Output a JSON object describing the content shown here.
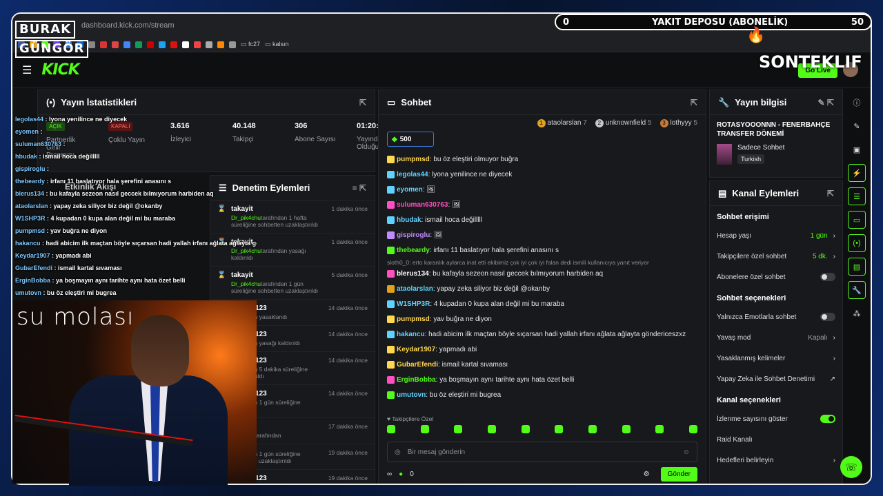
{
  "browser": {
    "url": "dashboard.kick.com/stream",
    "bookmarks": [
      "fc27",
      "kalsın"
    ]
  },
  "header": {
    "logo": "KICK",
    "go_live": "Go Live"
  },
  "stats_panel": {
    "title": "Yayın İstatistikleri",
    "items": [
      {
        "value": "AÇIK",
        "label": "Partnerlik Gelir Programı"
      },
      {
        "value": "KAPALI",
        "label": "Çoklu Yayın"
      },
      {
        "value": "3.616",
        "label": "İzleyici"
      },
      {
        "value": "40.148",
        "label": "Takipçi"
      },
      {
        "value": "306",
        "label": "Abone Sayısı"
      },
      {
        "value": "01:20:51",
        "label": "Yayında Olduğu Süre"
      }
    ]
  },
  "moderation": {
    "title": "Denetim Eylemleri",
    "items": [
      {
        "name": "takayit",
        "actor": "Dr_pik4chu",
        "sub": "tarafından 1 hafta süreliğine sohbetten uzaklaştırıldı",
        "time": "1 dakika önce"
      },
      {
        "name": "takayit",
        "actor": "Dr_pik4chu",
        "sub": "tarafından yasağı kaldırıldı",
        "time": "1 dakika önce"
      },
      {
        "name": "takayit",
        "actor": "Dr_pik4chu",
        "sub": "tarafından 1 gün süreliğine sohbetten uzaklaştırıldı",
        "time": "5 dakika önce"
      },
      {
        "name": "misreis123",
        "actor": "",
        "sub": "tarafından yasaklandı",
        "time": "14 dakika önce"
      },
      {
        "name": "misreis123",
        "actor": "",
        "sub": "tarafından yasağı kaldırıldı",
        "time": "14 dakika önce"
      },
      {
        "name": "misreis123",
        "actor": "",
        "sub": "tarafından 5 dakika süreliğine uzaklaştırıldı",
        "time": "14 dakika önce"
      },
      {
        "name": "misreis123",
        "actor": "",
        "sub": "tarafından 1 gün süreliğine sohbetten",
        "time": "14 dakika önce"
      },
      {
        "name": "quest",
        "actor": "Afforman",
        "sub": "tarafından",
        "time": "17 dakika önce"
      },
      {
        "name": "",
        "actor": "",
        "sub": "tarafından 1 gün süreliğine sohbetten uzaklaştırıldı",
        "time": "19 dakika önce"
      },
      {
        "name": "misreis123",
        "actor": "",
        "sub": "",
        "time": "19 dakika önce"
      }
    ]
  },
  "chat": {
    "title": "Sohbet",
    "top": [
      {
        "rank": "1",
        "name": "ataolarslan",
        "count": "7"
      },
      {
        "rank": "2",
        "name": "unknownfield",
        "count": "5"
      },
      {
        "rank": "3",
        "name": "lothyyy",
        "count": "5"
      }
    ],
    "pinned": "500",
    "messages": [
      {
        "user": "pumpmsd",
        "color": "#ffd84d",
        "text": "bu öz eleştiri olmuyor buğra"
      },
      {
        "user": "legolas44",
        "color": "#5fd3ff",
        "text": "lyona yenilince ne diyecek"
      },
      {
        "user": "eyomen",
        "color": "#5fd3ff",
        "text": ""
      },
      {
        "user": "suluman630763",
        "color": "#ff4fc0",
        "text": ""
      },
      {
        "user": "hbudak",
        "color": "#5fd3ff",
        "text": "ismail hoca değilllll"
      },
      {
        "user": "gispiroglu",
        "color": "#c08bff",
        "text": ""
      },
      {
        "user": "thebeardy",
        "color": "#53fc18",
        "text": "irfanı 11 baslatıyor hala şerefini anasını s"
      },
      {
        "user": "blerus134",
        "color": "#fff",
        "text": "bu kafayla sezeon nasıl geccek bılmıyorum harbiden aq"
      },
      {
        "user": "ataolarslan",
        "color": "#5fd3ff",
        "text": "yapay zeka siliyor biz değil @okanby"
      },
      {
        "user": "W1SHP3R",
        "color": "#5fd3ff",
        "text": "4 kupadan 0 kupa alan değil mi bu maraba"
      },
      {
        "user": "pumpmsd",
        "color": "#ffd84d",
        "text": "yav buğra ne diyon"
      },
      {
        "user": "hakancu",
        "color": "#5fd3ff",
        "text": "hadi abicim ilk maçtan böyle sıçarsan hadi yallah irfanı ağlata ağlayta göndericeszxz"
      },
      {
        "user": "Keydar1907",
        "color": "#ffd84d",
        "text": "yapmadı abi"
      },
      {
        "user": "GubarEfendi",
        "color": "#ffd84d",
        "text": "ismail kartal sıvaması"
      },
      {
        "user": "ErginBobba",
        "color": "#53fc18",
        "text": "ya boşmayın aynı tarihte aynı hata özet belli"
      },
      {
        "user": "umutovn",
        "color": "#5fd3ff",
        "text": "bu öz eleştiri mi bugrea"
      }
    ],
    "reply_note": "sloth0_0: erto karanlık aylarca inat etti ekibimiz çok iyi çok iyi falan dedi ismili kullanıcıya yanıt veriyor",
    "follow_note": "Takipçilere Özel",
    "input_placeholder": "Bir mesaj gönderin",
    "points": "0",
    "send": "Gönder"
  },
  "stream_info": {
    "title": "Yayın bilgisi",
    "stream_title": "ROTASYOOONNN - FENERBAHÇE TRANSFER DÖNEMİ",
    "category": "Sadece Sohbet",
    "language": "Turkish"
  },
  "channel_actions": {
    "title": "Kanal Eylemleri",
    "chat_access": "Sohbet erişimi",
    "rows1": [
      {
        "label": "Hesap yaşı",
        "value": "1 gün"
      },
      {
        "label": "Takipçilere özel sohbet",
        "value": "5 dk."
      },
      {
        "label": "Abonelere özel sohbet",
        "value": ""
      }
    ],
    "chat_options": "Sohbet seçenekleri",
    "rows2": [
      {
        "label": "Yalnızca Emotlarla sohbet",
        "value": ""
      },
      {
        "label": "Yavaş mod",
        "value": "Kapalı"
      },
      {
        "label": "Yasaklanmış kelimeler",
        "value": ""
      },
      {
        "label": "Yapay Zeka ile Sohbet Denetimi",
        "value": ""
      }
    ],
    "channel_options": "Kanal seçenekleri",
    "rows3": [
      {
        "label": "İzlenme sayısını göster",
        "value": ""
      },
      {
        "label": "Raid Kanalı",
        "value": ""
      },
      {
        "label": "Hedefleri belirleyin",
        "value": ""
      }
    ]
  },
  "overlay": {
    "brand_line1": "BURAK",
    "brand_line2": "GÜNGÖR",
    "fuel_min": "0",
    "fuel_title": "YAKIT DEPOSU (ABONELİK)",
    "fuel_max": "50",
    "sonteklif": "SONTEKLIF",
    "su_molasi": "su molası",
    "behind_panel": "Etkinlik Akışı",
    "chat_lines": [
      {
        "user": "legolas44",
        "text": "lyona yenilince ne diyecek"
      },
      {
        "user": "eyomen",
        "text": ""
      },
      {
        "user": "suluman630763",
        "text": ""
      },
      {
        "user": "hbudak",
        "text": "ismail hoca değilllll"
      },
      {
        "user": "gispiroglu",
        "text": ""
      },
      {
        "user": "thebeardy",
        "text": "irfanı 11 baslatıyor hala şerefini anasını s"
      },
      {
        "user": "blerus134",
        "text": "bu kafayla sezeon nasıl geccek bılmıyorum harbiden aq"
      },
      {
        "user": "ataolarslan",
        "text": "yapay zeka siliyor biz değil @okanby"
      },
      {
        "user": "W1SHP3R",
        "text": "4 kupadan 0 kupa alan değil mi bu maraba"
      },
      {
        "user": "pumpmsd",
        "text": "yav buğra ne diyon"
      },
      {
        "user": "hakancu",
        "text": "hadi abicim ilk maçtan böyle sıçarsan hadi yallah irfanı ağlata ağlayta göndericeszxz"
      },
      {
        "user": "Keydar1907",
        "text": "yapmadı abi"
      },
      {
        "user": "GubarEfendi",
        "text": "ismail kartal sıvaması"
      },
      {
        "user": "ErginBobba",
        "text": "ya boşmayın aynı tarihte aynı hata özet belli"
      },
      {
        "user": "umutovn",
        "text": "bu öz eleştiri mi bugrea"
      }
    ]
  },
  "colors": {
    "accent": "#53fc18",
    "panel": "#18191c",
    "background": "#111214"
  }
}
